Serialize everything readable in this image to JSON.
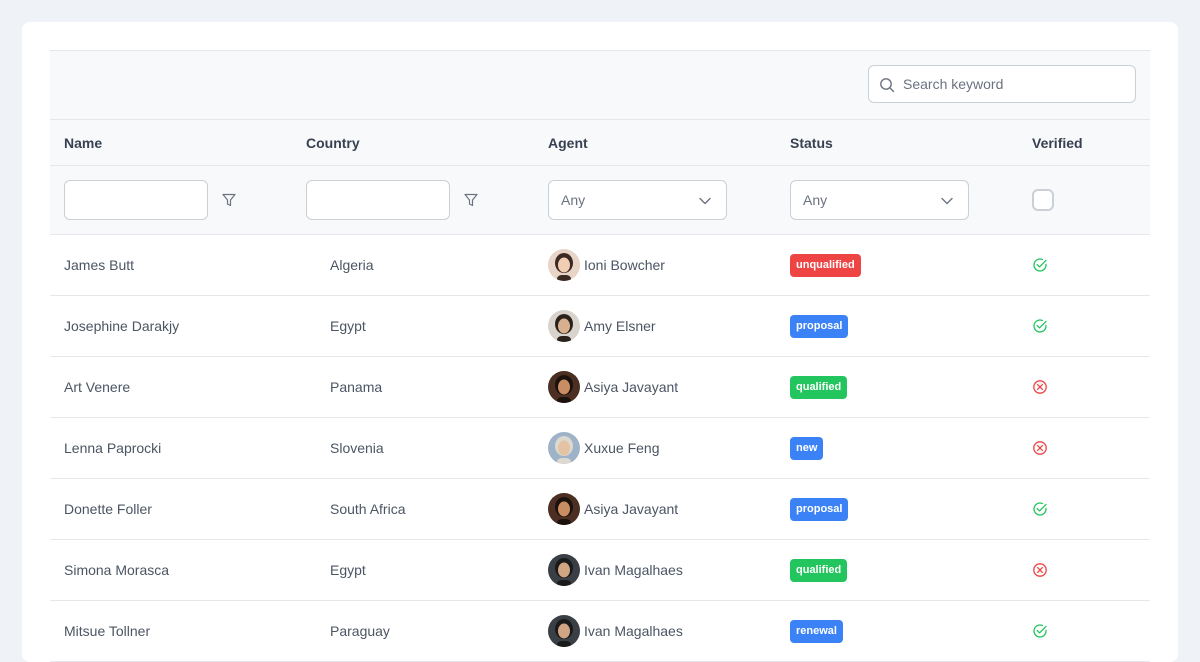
{
  "search": {
    "placeholder": "Search keyword"
  },
  "columns": {
    "name": "Name",
    "country": "Country",
    "agent": "Agent",
    "status": "Status",
    "verified": "Verified"
  },
  "filters": {
    "agent_value": "Any",
    "status_value": "Any"
  },
  "colors": {
    "unqualified": "#ef4444",
    "proposal": "#3b82f6",
    "qualified": "#22c55e",
    "new": "#3b82f6",
    "renewal": "#3b82f6",
    "verified_true": "#22c55e",
    "verified_false": "#ef4444"
  },
  "rows": [
    {
      "name": "James Butt",
      "country": "Algeria",
      "agent": "Ioni Bowcher",
      "status": "unqualified",
      "verified": true
    },
    {
      "name": "Josephine Darakjy",
      "country": "Egypt",
      "agent": "Amy Elsner",
      "status": "proposal",
      "verified": true
    },
    {
      "name": "Art Venere",
      "country": "Panama",
      "agent": "Asiya Javayant",
      "status": "qualified",
      "verified": false
    },
    {
      "name": "Lenna Paprocki",
      "country": "Slovenia",
      "agent": "Xuxue Feng",
      "status": "new",
      "verified": false
    },
    {
      "name": "Donette Foller",
      "country": "South Africa",
      "agent": "Asiya Javayant",
      "status": "proposal",
      "verified": true
    },
    {
      "name": "Simona Morasca",
      "country": "Egypt",
      "agent": "Ivan Magalhaes",
      "status": "qualified",
      "verified": false
    },
    {
      "name": "Mitsue Tollner",
      "country": "Paraguay",
      "agent": "Ivan Magalhaes",
      "status": "renewal",
      "verified": true
    }
  ]
}
